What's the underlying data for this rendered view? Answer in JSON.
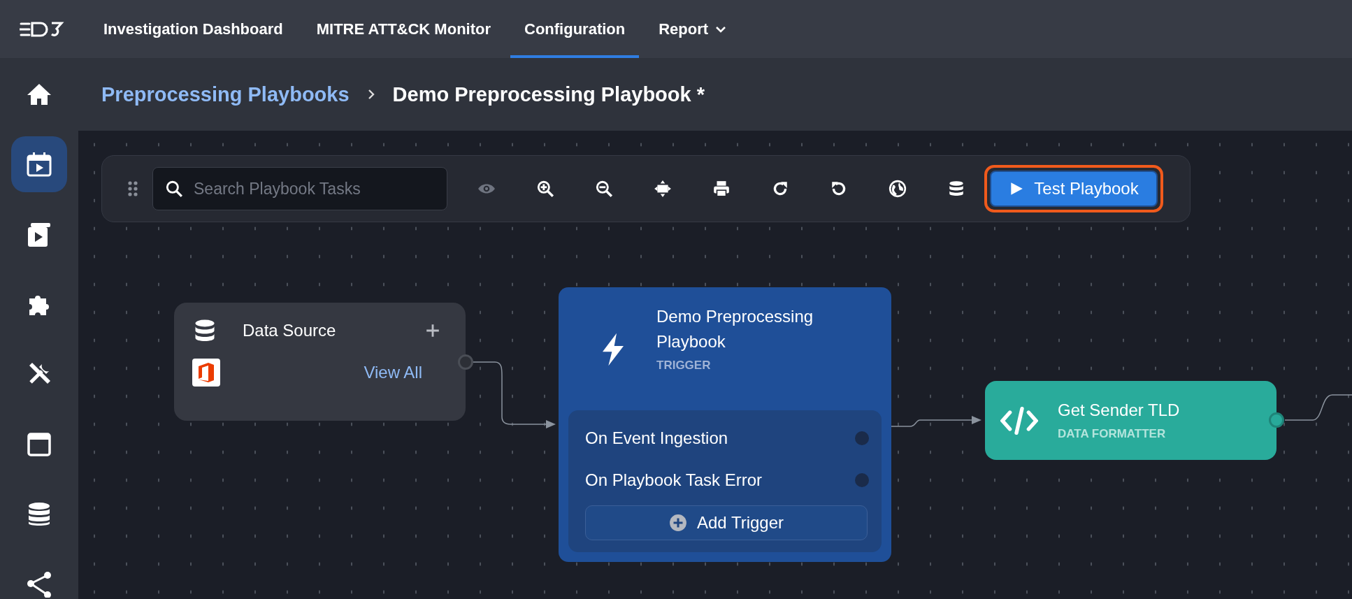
{
  "nav": {
    "items": [
      {
        "label": "Investigation Dashboard",
        "selected": false,
        "dropdown": false
      },
      {
        "label": "MITRE ATT&CK Monitor",
        "selected": false,
        "dropdown": false
      },
      {
        "label": "Configuration",
        "selected": true,
        "dropdown": false
      },
      {
        "label": "Report",
        "selected": false,
        "dropdown": true
      }
    ]
  },
  "sidebar": {
    "items": [
      {
        "selected": false
      },
      {
        "selected": true
      },
      {
        "selected": false
      },
      {
        "selected": false
      },
      {
        "selected": false
      },
      {
        "selected": false
      },
      {
        "selected": false
      },
      {
        "selected": false
      }
    ]
  },
  "breadcrumb": {
    "parent": "Preprocessing Playbooks",
    "current": "Demo Preprocessing Playbook *"
  },
  "toolbar": {
    "search": {
      "placeholder": "Search Playbook Tasks"
    },
    "tools": [
      {
        "disabled": true
      },
      {
        "disabled": false
      },
      {
        "disabled": false
      },
      {
        "disabled": false
      },
      {
        "disabled": false
      },
      {
        "disabled": false
      },
      {
        "disabled": false
      },
      {
        "disabled": false
      },
      {
        "disabled": false
      }
    ],
    "test_button": {
      "label": "Test Playbook",
      "highlighted": true
    }
  },
  "data_source": {
    "title": "Data Source",
    "link": "View All"
  },
  "trigger": {
    "title": "Demo Preprocessing Playbook",
    "subtitle": "TRIGGER",
    "events": [
      {
        "label": "On Event Ingestion"
      },
      {
        "label": "On Playbook Task Error"
      }
    ],
    "add_button": "Add Trigger"
  },
  "task": {
    "title": "Get Sender TLD",
    "subtitle": "DATA FORMATTER"
  }
}
